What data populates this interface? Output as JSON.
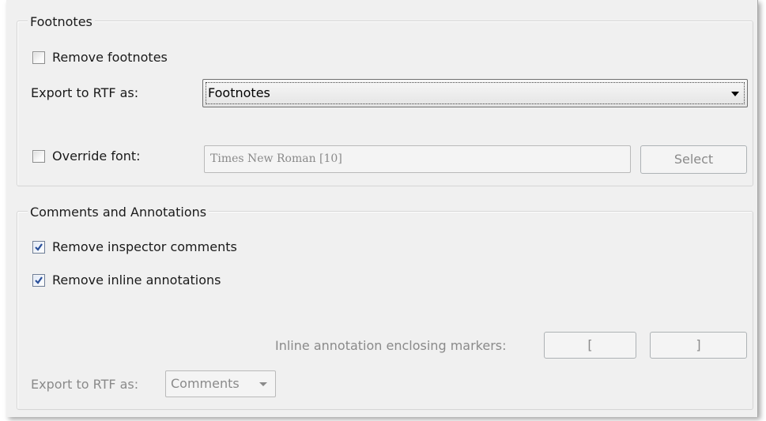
{
  "footnotes": {
    "legend": "Footnotes",
    "remove_footnotes_label": "Remove footnotes",
    "remove_footnotes_checked": false,
    "export_label": "Export to RTF as:",
    "export_value": "Footnotes",
    "override_font_label": "Override font:",
    "override_font_checked": false,
    "font_value": "Times New Roman [10]",
    "select_button_label": "Select"
  },
  "comments": {
    "legend": "Comments and Annotations",
    "remove_inspector_label": "Remove inspector comments",
    "remove_inspector_checked": true,
    "remove_inline_label": "Remove inline annotations",
    "remove_inline_checked": true,
    "markers_label": "Inline annotation enclosing markers:",
    "open_marker": "[",
    "close_marker": "]",
    "export_label": "Export to RTF as:",
    "export_value": "Comments"
  },
  "colors": {
    "panel_bg": "#f0f0f0",
    "check_mark": "#2a4f99",
    "disabled_text": "#8a8a8a"
  }
}
